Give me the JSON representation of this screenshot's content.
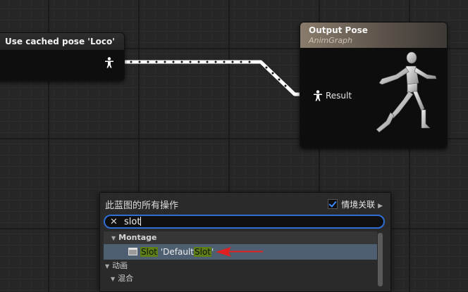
{
  "graph": {
    "cached_pose_node": {
      "title": "Use cached pose 'Loco'"
    },
    "output_pose_node": {
      "title": "Output Pose",
      "subtitle": "AnimGraph",
      "pin_label": "Result"
    }
  },
  "action_menu": {
    "title": "此蓝图的所有操作",
    "context_sensitive_label": "情境关联",
    "context_sensitive_checked": true,
    "search_value": "slot",
    "categories": [
      {
        "label": "Montage"
      }
    ],
    "selected_item": {
      "part1": "Slot",
      "part2": " 'Default",
      "part3": "Slot",
      "part4": "'"
    },
    "other_categories": [
      "动画",
      "混合"
    ]
  },
  "colors": {
    "accent": "#2e6fd6",
    "highlight": "#5d7f16",
    "selection": "#4e5f71",
    "annotation_arrow": "#e02020"
  }
}
